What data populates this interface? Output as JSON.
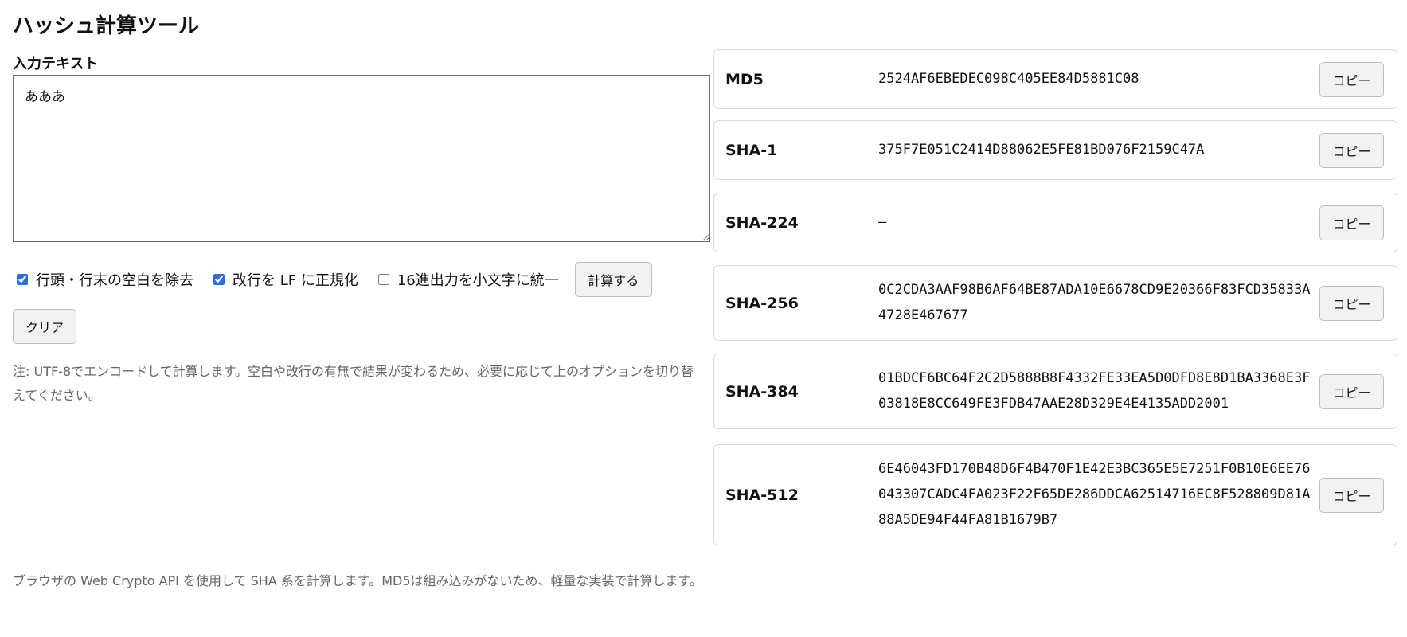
{
  "title": "ハッシュ計算ツール",
  "input": {
    "label": "入力テキスト",
    "value": "あああ"
  },
  "options": {
    "trim": {
      "label": "行頭・行末の空白を除去",
      "checked": true
    },
    "normalize_lf": {
      "label": "改行を LF に正規化",
      "checked": true
    },
    "lowercase": {
      "label": "16進出力を小文字に統一",
      "checked": false
    }
  },
  "buttons": {
    "calculate": "計算する",
    "clear": "クリア",
    "copy": "コピー"
  },
  "note": "注: UTF-8でエンコードして計算します。空白や改行の有無で結果が変わるため、必要に応じて上のオプションを切り替えてください。",
  "footer": "ブラウザの Web Crypto API を使用して SHA 系を計算します。MD5は組み込みがないため、軽量な実装で計算します。",
  "results": [
    {
      "name": "MD5",
      "value": "2524AF6EBEDEC098C405EE84D5881C08"
    },
    {
      "name": "SHA-1",
      "value": "375F7E051C2414D88062E5FE81BD076F2159C47A"
    },
    {
      "name": "SHA-224",
      "value": "–"
    },
    {
      "name": "SHA-256",
      "value": "0C2CDA3AAF98B6AF64BE87ADA10E6678CD9E20366F83FCD35833A4728E467677"
    },
    {
      "name": "SHA-384",
      "value": "01BDCF6BC64F2C2D5888B8F4332FE33EA5D0DFD8E8D1BA3368E3F03818E8CC649FE3FDB47AAE28D329E4E4135ADD2001"
    },
    {
      "name": "SHA-512",
      "value": "6E46043FD170B48D6F4B470F1E42E3BC365E5E7251F0B10E6EE76043307CADC4FA023F22F65DE286DDCA62514716EC8F528809D81A88A5DE94F44FA81B1679B7"
    }
  ]
}
